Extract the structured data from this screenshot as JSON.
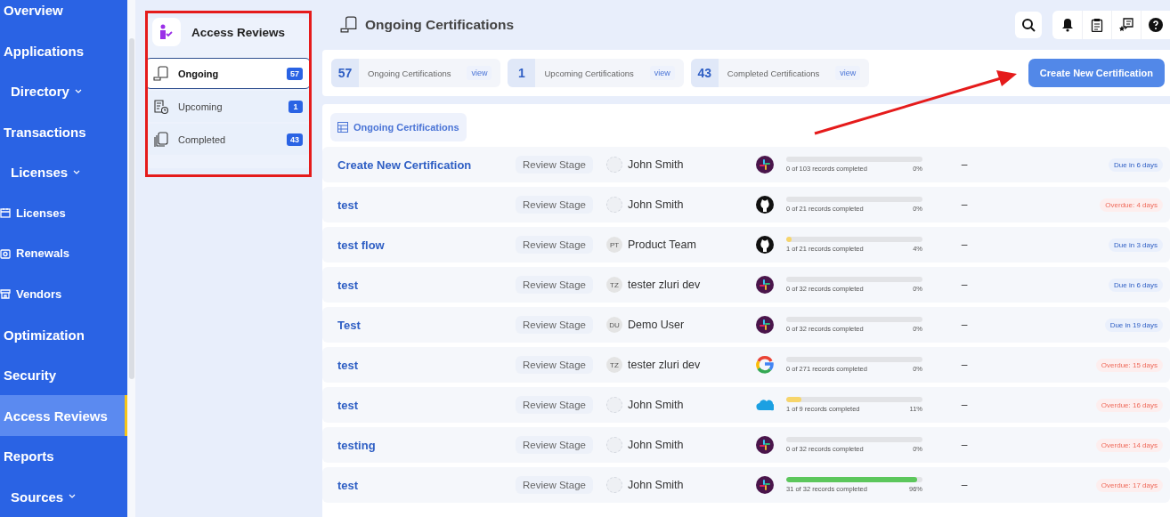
{
  "sidebar": {
    "items": [
      {
        "label": "Overview",
        "kind": "top",
        "selected": false
      },
      {
        "label": "Applications",
        "kind": "top",
        "selected": false
      },
      {
        "label": "Directory",
        "kind": "group",
        "selected": false
      },
      {
        "label": "Transactions",
        "kind": "top",
        "selected": false
      },
      {
        "label": "Licenses",
        "kind": "group",
        "selected": false
      },
      {
        "label": "Licenses",
        "kind": "sub",
        "selected": false
      },
      {
        "label": "Renewals",
        "kind": "sub",
        "selected": false
      },
      {
        "label": "Vendors",
        "kind": "sub",
        "selected": false
      },
      {
        "label": "Optimization",
        "kind": "top",
        "selected": false
      },
      {
        "label": "Security",
        "kind": "top",
        "selected": false
      },
      {
        "label": "Access Reviews",
        "kind": "top",
        "selected": true
      },
      {
        "label": "Reports",
        "kind": "top",
        "selected": false
      },
      {
        "label": "Sources",
        "kind": "group",
        "selected": false
      }
    ]
  },
  "subnav": {
    "title": "Access Reviews",
    "items": [
      {
        "label": "Ongoing",
        "count": "57",
        "selected": true
      },
      {
        "label": "Upcoming",
        "count": "1",
        "selected": false
      },
      {
        "label": "Completed",
        "count": "43",
        "selected": false
      }
    ]
  },
  "header": {
    "title": "Ongoing Certifications"
  },
  "stats": [
    {
      "count": "57",
      "label": "Ongoing Certifications",
      "link": "view"
    },
    {
      "count": "1",
      "label": "Upcoming Certifications",
      "link": "view"
    },
    {
      "count": "43",
      "label": "Completed Certifications",
      "link": "view"
    }
  ],
  "create_button": "Create New Certification",
  "list_tab": "Ongoing Certifications",
  "rows": [
    {
      "name": "Create New Certification",
      "stage": "Review Stage",
      "owner": "John Smith",
      "kind": "slack",
      "level": 0,
      "records": "0 of 103 records completed",
      "percent": "0%",
      "reviewer": "–",
      "due": "Due in 6 days",
      "overdue": false
    },
    {
      "name": "test",
      "stage": "Review Stage",
      "owner": "John Smith",
      "kind": "github",
      "level": 0,
      "records": "0 of 21 records completed",
      "percent": "0%",
      "reviewer": "–",
      "due": "Overdue: 4 days",
      "overdue": true
    },
    {
      "name": "test flow",
      "stage": "Review Stage",
      "initials": "PT",
      "owner": "Product Team",
      "kind": "github",
      "level": 0.04,
      "records": "1 of 21 records completed",
      "percent": "4%",
      "reviewer": "–",
      "due": "Due in 3 days",
      "overdue": false
    },
    {
      "name": "test",
      "stage": "Review Stage",
      "initials": "TZ",
      "owner": "tester zluri dev",
      "kind": "slack",
      "level": 0,
      "records": "0 of 32 records completed",
      "percent": "0%",
      "reviewer": "–",
      "due": "Due in 6 days",
      "overdue": false
    },
    {
      "name": "Test",
      "stage": "Review Stage",
      "initials": "DU",
      "owner": "Demo User",
      "kind": "slack",
      "level": 0,
      "records": "0 of 32 records completed",
      "percent": "0%",
      "reviewer": "–",
      "due": "Due in 19 days",
      "overdue": false
    },
    {
      "name": "test",
      "stage": "Review Stage",
      "initials": "TZ",
      "owner": "tester zluri dev",
      "kind": "google",
      "level": 0,
      "records": "0 of 271 records completed",
      "percent": "0%",
      "reviewer": "–",
      "due": "Overdue: 15 days",
      "overdue": true
    },
    {
      "name": "test",
      "stage": "Review Stage",
      "owner": "John Smith",
      "kind": "salesforce",
      "level": 0.11,
      "records": "1 of 9 records completed",
      "percent": "11%",
      "reviewer": "–",
      "due": "Overdue: 16 days",
      "overdue": true
    },
    {
      "name": "testing",
      "stage": "Review Stage",
      "owner": "John Smith",
      "kind": "slack",
      "level": 0,
      "records": "0 of 32 records completed",
      "percent": "0%",
      "reviewer": "–",
      "due": "Overdue: 14 days",
      "overdue": true
    },
    {
      "name": "test",
      "stage": "Review Stage",
      "owner": "John Smith",
      "kind": "slack",
      "level": 0.96,
      "records": "31 of 32 records completed",
      "percent": "96%",
      "reviewer": "–",
      "due": "Overdue: 17 days",
      "overdue": true
    }
  ]
}
